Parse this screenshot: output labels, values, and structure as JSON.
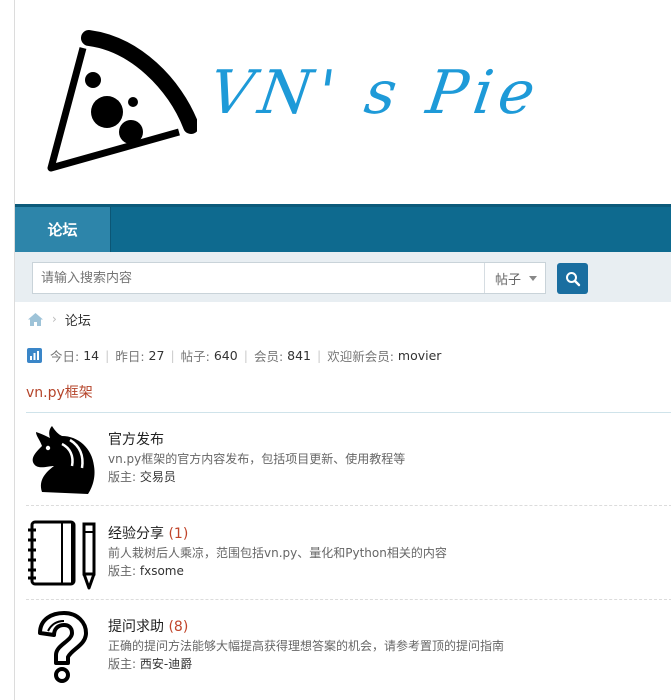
{
  "brand": {
    "logo_text": "VN' s Pie",
    "logo_color": "#1e9ad8"
  },
  "nav": {
    "items": [
      {
        "label": "论坛",
        "active": true
      }
    ]
  },
  "search": {
    "placeholder": "请输入搜索内容",
    "type_selected": "帖子",
    "icon": "search-icon"
  },
  "breadcrumb": {
    "home_icon": "home-icon",
    "current": "论坛"
  },
  "stats": {
    "today_label": "今日:",
    "today_value": "14",
    "yesterday_label": "昨日:",
    "yesterday_value": "27",
    "posts_label": "帖子:",
    "posts_value": "640",
    "members_label": "会员:",
    "members_value": "841",
    "welcome_label": "欢迎新会员:",
    "welcome_value": "movier"
  },
  "category": {
    "title": "vn.py框架",
    "forums": [
      {
        "name": "官方发布",
        "count": "",
        "description": "vn.py框架的官方内容发布，包括项目更新、使用教程等",
        "moderator_label": "版主:",
        "moderator": "交易员",
        "icon": "knight-icon"
      },
      {
        "name": "经验分享",
        "count": "(1)",
        "description": "前人栽树后人乘凉，范围包括vn.py、量化和Python相关的内容",
        "moderator_label": "版主:",
        "moderator": "fxsome",
        "icon": "notebook-pencil-icon"
      },
      {
        "name": "提问求助",
        "count": "(8)",
        "description": "正确的提问方法能够大幅提高获得理想答案的机会，请参考置顶的提问指南",
        "moderator_label": "版主:",
        "moderator": "西安-迪爵",
        "icon": "question-icon"
      }
    ]
  }
}
